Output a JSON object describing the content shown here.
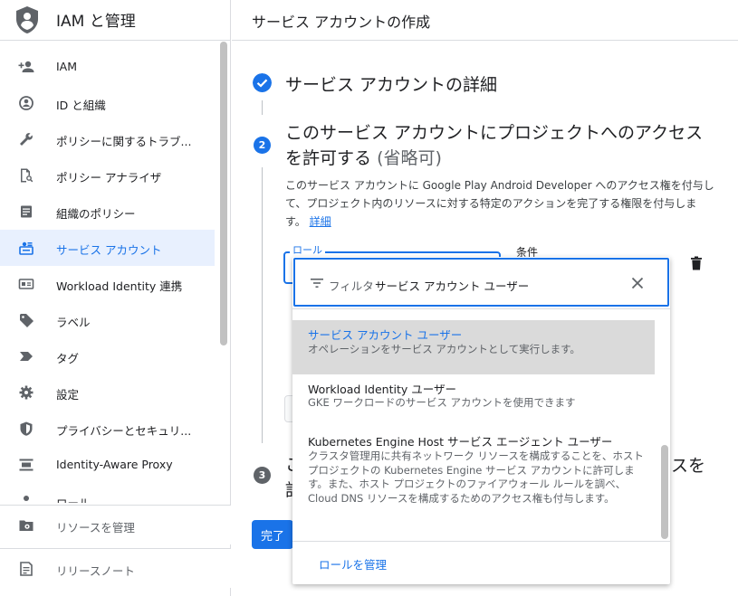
{
  "sidebar": {
    "title": "IAM と管理",
    "items": [
      {
        "label": "IAM",
        "icon": "add-person-icon"
      },
      {
        "label": "ID と組織",
        "icon": "account-circle-icon"
      },
      {
        "label": "ポリシーに関するトラブ...",
        "icon": "wrench-icon"
      },
      {
        "label": "ポリシー アナライザ",
        "icon": "document-search-icon"
      },
      {
        "label": "組織のポリシー",
        "icon": "list-doc-icon"
      },
      {
        "label": "サービス アカウント",
        "icon": "service-account-icon",
        "active": true
      },
      {
        "label": "Workload Identity 連携",
        "icon": "id-card-icon"
      },
      {
        "label": "ラベル",
        "icon": "tag-icon"
      },
      {
        "label": "タグ",
        "icon": "arrow-tag-icon"
      },
      {
        "label": "設定",
        "icon": "gear-icon"
      },
      {
        "label": "プライバシーとセキュリ...",
        "icon": "shield-icon"
      },
      {
        "label": "Identity-Aware Proxy",
        "icon": "proxy-icon"
      },
      {
        "label": "ロール",
        "icon": "role-icon"
      }
    ],
    "bottom": [
      {
        "label": "リソースを管理",
        "icon": "folder-gear-icon"
      },
      {
        "label": "リリースノート",
        "icon": "notes-icon"
      }
    ]
  },
  "main": {
    "page_title": "サービス アカウントの作成",
    "step1_title": "サービス アカウントの詳細",
    "step2_number": "2",
    "step2_title": "このサービス アカウントにプロジェクトへのアクセスを許可する",
    "step2_optional": "(省略可)",
    "step2_desc": "このサービス アカウントに Google Play Android Developer へのアクセス権を付与して、プロジェクト内のリソースに対する特定のアクションを完了する権限を付与します。",
    "step2_link": "詳細",
    "role_label": "ロール",
    "condition_label": "条件",
    "step3_number": "3",
    "step3_title_visible": "こ",
    "step3_title_line2": "許",
    "step3_right": "スを",
    "done_button": "完了"
  },
  "dropdown": {
    "filter_label": "フィルタ",
    "filter_value": "サービス アカウント ユーザー",
    "options": [
      {
        "name": "サービス アカウント ユーザー",
        "desc": "オペレーションをサービス アカウントとして実行します。",
        "selected": true
      },
      {
        "name": "Workload Identity ユーザー",
        "desc": "GKE ワークロードのサービス アカウントを使用できます"
      },
      {
        "name": "Kubernetes Engine Host サービス エージェント ユーザー",
        "desc": "クラスタ管理用に共有ネットワーク リソースを構成することを、ホスト プロジェクトの Kubernetes Engine サービス アカウントに許可します。また、ホスト プロジェクトのファイアウォール ルールを調べ、Cloud DNS リソースを構成するためのアクセス権も付与します。"
      }
    ],
    "manage_roles": "ロールを管理"
  },
  "colors": {
    "accent": "#1a73e8",
    "active_bg": "#e8f0fe",
    "step_grey": "#5f6368"
  }
}
